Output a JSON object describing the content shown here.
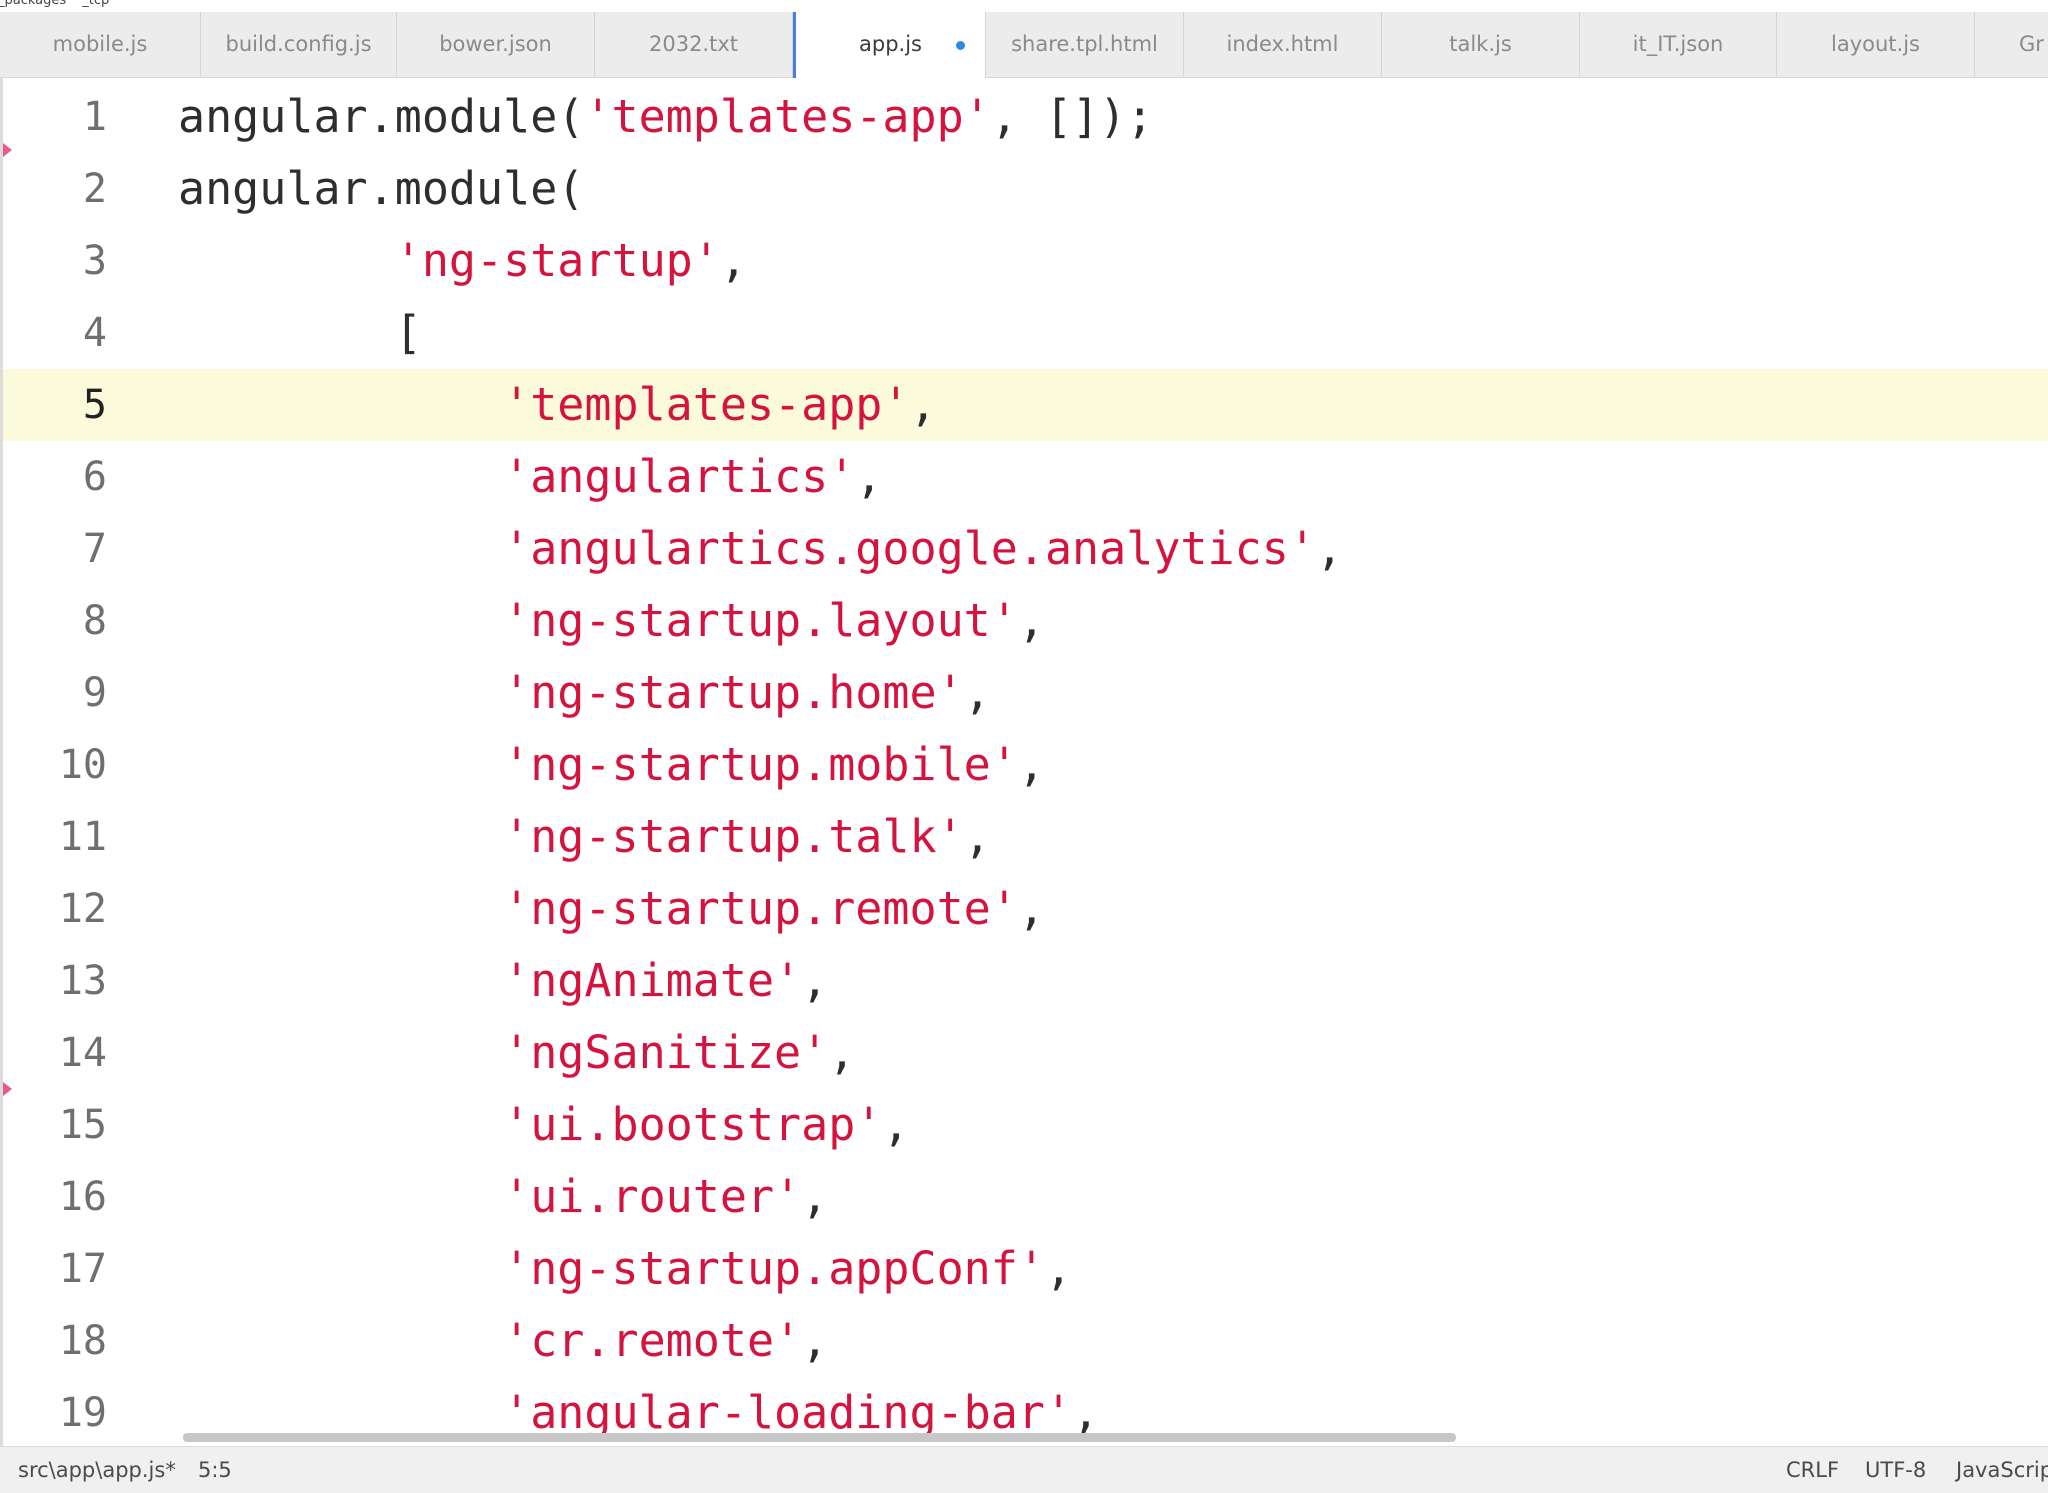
{
  "breadcrumb": [
    "_packages",
    "_tcp"
  ],
  "tabs": [
    {
      "label": "mobile.js",
      "active": false
    },
    {
      "label": "build.config.js",
      "active": false
    },
    {
      "label": "bower.json",
      "active": false
    },
    {
      "label": "2032.txt",
      "active": false
    },
    {
      "label": "app.js",
      "active": true,
      "modified": true
    },
    {
      "label": "share.tpl.html",
      "active": false
    },
    {
      "label": "index.html",
      "active": false
    },
    {
      "label": "talk.js",
      "active": false
    },
    {
      "label": "it_IT.json",
      "active": false
    },
    {
      "label": "layout.js",
      "active": false
    },
    {
      "label": "Gr",
      "active": false
    }
  ],
  "editor": {
    "current_line": 5,
    "lines": [
      {
        "n": "1",
        "pre": "angular.module(",
        "str": "'templates-app'",
        "post": ", []);"
      },
      {
        "n": "2",
        "pre": "angular.module(",
        "str": "",
        "post": ""
      },
      {
        "n": "3",
        "pre": "        ",
        "str": "'ng-startup'",
        "post": ","
      },
      {
        "n": "4",
        "pre": "        [",
        "str": "",
        "post": ""
      },
      {
        "n": "5",
        "pre": "            ",
        "str": "'templates-app'",
        "post": ","
      },
      {
        "n": "6",
        "pre": "            ",
        "str": "'angulartics'",
        "post": ","
      },
      {
        "n": "7",
        "pre": "            ",
        "str": "'angulartics.google.analytics'",
        "post": ","
      },
      {
        "n": "8",
        "pre": "            ",
        "str": "'ng-startup.layout'",
        "post": ","
      },
      {
        "n": "9",
        "pre": "            ",
        "str": "'ng-startup.home'",
        "post": ","
      },
      {
        "n": "10",
        "pre": "            ",
        "str": "'ng-startup.mobile'",
        "post": ","
      },
      {
        "n": "11",
        "pre": "            ",
        "str": "'ng-startup.talk'",
        "post": ","
      },
      {
        "n": "12",
        "pre": "            ",
        "str": "'ng-startup.remote'",
        "post": ","
      },
      {
        "n": "13",
        "pre": "            ",
        "str": "'ngAnimate'",
        "post": ","
      },
      {
        "n": "14",
        "pre": "            ",
        "str": "'ngSanitize'",
        "post": ","
      },
      {
        "n": "15",
        "pre": "            ",
        "str": "'ui.bootstrap'",
        "post": ","
      },
      {
        "n": "16",
        "pre": "            ",
        "str": "'ui.router'",
        "post": ","
      },
      {
        "n": "17",
        "pre": "            ",
        "str": "'ng-startup.appConf'",
        "post": ","
      },
      {
        "n": "18",
        "pre": "            ",
        "str": "'cr.remote'",
        "post": ","
      },
      {
        "n": "19",
        "pre": "            ",
        "str": "'angular-loading-bar'",
        "post": ","
      }
    ]
  },
  "status": {
    "file": "src\\app\\app.js*",
    "position": "5:5",
    "line_ending": "CRLF",
    "encoding": "UTF-8",
    "language": "JavaScript"
  },
  "colors": {
    "string": "#d4143f",
    "current_line_bg": "#fbfbdc",
    "active_tab_accent": "#4a7fd4",
    "modified_dot": "#2f8ae6"
  }
}
